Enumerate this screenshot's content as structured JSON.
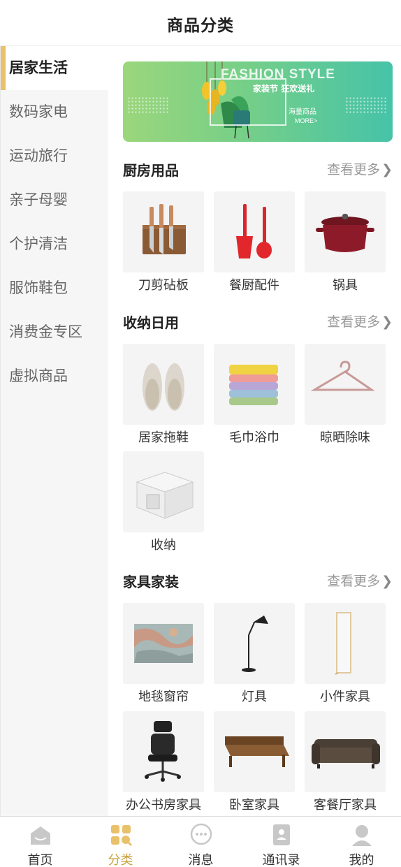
{
  "header": {
    "title": "商品分类"
  },
  "sidebar": {
    "items": [
      {
        "label": "居家生活",
        "active": true
      },
      {
        "label": "数码家电"
      },
      {
        "label": "运动旅行"
      },
      {
        "label": "亲子母婴"
      },
      {
        "label": "个护清洁"
      },
      {
        "label": "服饰鞋包"
      },
      {
        "label": "消费金专区"
      },
      {
        "label": "虚拟商品"
      }
    ]
  },
  "banner": {
    "title": "FASHION STYLE",
    "subtitle": "家装节 狂欢送礼",
    "sub2": "海量商品",
    "more": "MORE>"
  },
  "sections": [
    {
      "title": "厨房用品",
      "more": "查看更多",
      "items": [
        {
          "label": "刀剪砧板",
          "icon": "knife-block-icon"
        },
        {
          "label": "餐厨配件",
          "icon": "spatula-ladle-icon"
        },
        {
          "label": "锅具",
          "icon": "pot-icon"
        }
      ]
    },
    {
      "title": "收纳日用",
      "more": "查看更多",
      "items": [
        {
          "label": "居家拖鞋",
          "icon": "slippers-icon"
        },
        {
          "label": "毛巾浴巾",
          "icon": "towels-icon"
        },
        {
          "label": "晾晒除味",
          "icon": "hanger-icon"
        },
        {
          "label": "收纳",
          "icon": "storage-box-icon"
        }
      ]
    },
    {
      "title": "家具家装",
      "more": "查看更多",
      "items": [
        {
          "label": "地毯窗帘",
          "icon": "rug-icon"
        },
        {
          "label": "灯具",
          "icon": "floor-lamp-icon"
        },
        {
          "label": "小件家具",
          "icon": "mirror-icon"
        },
        {
          "label": "办公书房家具",
          "icon": "office-chair-icon"
        },
        {
          "label": "卧室家具",
          "icon": "bed-icon"
        },
        {
          "label": "客餐厅家具",
          "icon": "sofa-icon"
        }
      ]
    }
  ],
  "tabbar": {
    "items": [
      {
        "label": "首页",
        "icon": "home-icon"
      },
      {
        "label": "分类",
        "icon": "category-icon",
        "active": true
      },
      {
        "label": "消息",
        "icon": "message-icon"
      },
      {
        "label": "通讯录",
        "icon": "contacts-icon"
      },
      {
        "label": "我的",
        "icon": "user-icon"
      }
    ]
  },
  "colors": {
    "accent": "#e8c16a",
    "active_tab": "#caa23f"
  }
}
